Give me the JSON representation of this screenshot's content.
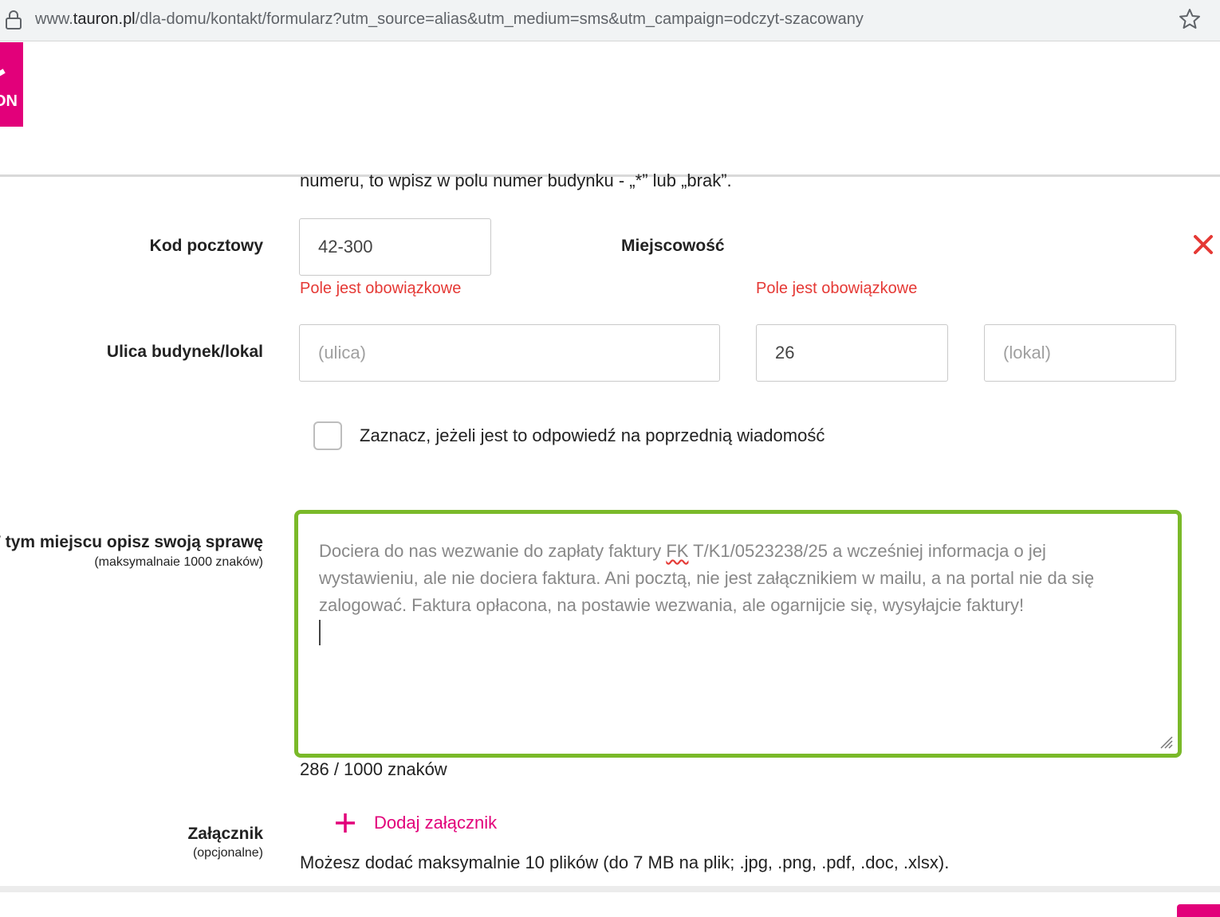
{
  "browser": {
    "url_prefix": "www.",
    "url_domain": "tauron.pl",
    "url_path": "/dla-domu/kontakt/formularz?utm_source=alias&utm_medium=sms&utm_campaign=odczyt-szacowany"
  },
  "header": {
    "logo_text": "ON",
    "brand_color": "#e2007a"
  },
  "form": {
    "intro_cut_text": "numeru, to wpisz w polu numer budynku - „*” lub „brak”.",
    "postal": {
      "label": "Kod pocztowy",
      "value": "42-300",
      "error": "Pole jest obowiązkowe"
    },
    "city": {
      "label": "Miejscowość",
      "error": "Pole jest obowiązkowe"
    },
    "street": {
      "label": "Ulica budynek/lokal",
      "street_placeholder": "(ulica)",
      "building_value": "26",
      "unit_placeholder": "(lokal)"
    },
    "reply_checkbox": {
      "label": "Zaznacz, jeżeli jest to odpowiedź na poprzednią wiadomość",
      "checked": false
    },
    "description": {
      "label": "W tym miejscu opisz swoją sprawę",
      "sublabel": "(maksymalnaie 1000 znaków)",
      "text_before": "Dociera do nas wezwanie do zapłaty faktury ",
      "text_flagged": "FK",
      "text_after": " T/K1/0523238/25 a wcześniej informacja o jej wystawieniu, ale nie dociera faktura. Ani pocztą, nie jest załącznikiem w mailu, a na portal nie da się zalogować. Faktura opłacona, na postawie wezwania, ale ogarnijcie się, wysyłajcie faktury!",
      "counter": "286 / 1000 znaków",
      "focus_color": "#7ab929"
    },
    "attachment": {
      "label": "Załącznik",
      "sublabel": "(opcjonalne)",
      "add_label": "Dodaj załącznik",
      "info": "Możesz dodać maksymalnie 10 plików (do 7 MB na plik; .jpg, .png, .pdf, .doc, .xlsx)."
    },
    "error_color": "#e53935"
  },
  "icons": {
    "lock": "lock-icon",
    "star": "star-icon",
    "close": "close-icon",
    "plus": "plus-icon",
    "resize": "resize-handle-icon"
  }
}
